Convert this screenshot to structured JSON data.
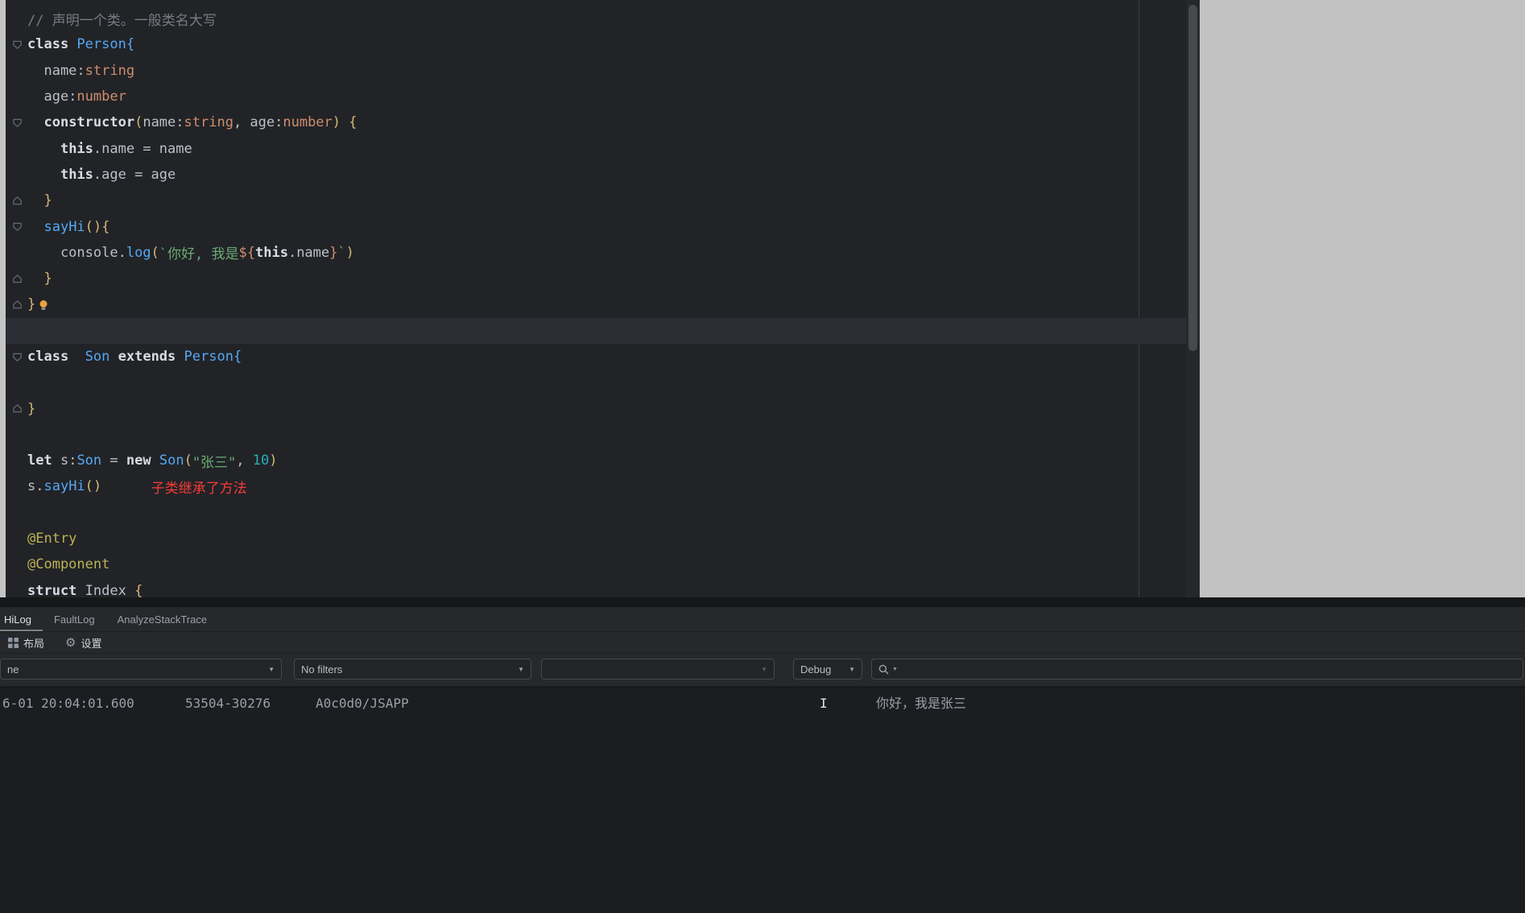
{
  "colors": {
    "annotation_red": "#f53b3b",
    "bulb_yellow": "#e9a33f",
    "class_blue": "#56a8f5",
    "string_green": "#6aab73"
  },
  "editor": {
    "lines": [
      {
        "tokens": [
          {
            "t": "// 声明一个类。一般类名大写",
            "k": "cm"
          }
        ]
      },
      {
        "marker": "down",
        "tokens": [
          {
            "t": "class ",
            "k": "kw"
          },
          {
            "t": "Person{",
            "k": "cls"
          }
        ]
      },
      {
        "tokens": [
          {
            "t": "  name:",
            "k": "fg"
          },
          {
            "t": "string",
            "k": "type"
          }
        ]
      },
      {
        "tokens": [
          {
            "t": "  age:",
            "k": "fg"
          },
          {
            "t": "number",
            "k": "type"
          }
        ]
      },
      {
        "marker": "down",
        "tokens": [
          {
            "t": "  ",
            "k": "fg"
          },
          {
            "t": "constructor",
            "k": "kw"
          },
          {
            "t": "(",
            "k": "paren"
          },
          {
            "t": "name:",
            "k": "fg"
          },
          {
            "t": "string",
            "k": "type"
          },
          {
            "t": ", age:",
            "k": "fg"
          },
          {
            "t": "number",
            "k": "type"
          },
          {
            "t": ")",
            "k": "paren"
          },
          {
            "t": " ",
            "k": "fg"
          },
          {
            "t": "{",
            "k": "paren"
          }
        ]
      },
      {
        "tokens": [
          {
            "t": "    ",
            "k": "fg"
          },
          {
            "t": "this",
            "k": "kw"
          },
          {
            "t": ".name = name",
            "k": "fg"
          }
        ]
      },
      {
        "tokens": [
          {
            "t": "    ",
            "k": "fg"
          },
          {
            "t": "this",
            "k": "kw"
          },
          {
            "t": ".age = age",
            "k": "fg"
          }
        ]
      },
      {
        "marker": "up",
        "tokens": [
          {
            "t": "  ",
            "k": "fg"
          },
          {
            "t": "}",
            "k": "paren"
          }
        ]
      },
      {
        "marker": "down",
        "tokens": [
          {
            "t": "  ",
            "k": "fg"
          },
          {
            "t": "sayHi",
            "k": "cls"
          },
          {
            "t": "(){",
            "k": "paren"
          }
        ]
      },
      {
        "tokens": [
          {
            "t": "    console.",
            "k": "fg"
          },
          {
            "t": "log",
            "k": "cls"
          },
          {
            "t": "(",
            "k": "paren"
          },
          {
            "t": "`你好, 我是",
            "k": "str"
          },
          {
            "t": "${",
            "k": "type"
          },
          {
            "t": "this",
            "k": "kw"
          },
          {
            "t": ".name",
            "k": "fg"
          },
          {
            "t": "}",
            "k": "type"
          },
          {
            "t": "`",
            "k": "str"
          },
          {
            "t": ")",
            "k": "paren"
          }
        ]
      },
      {
        "marker": "up",
        "tokens": [
          {
            "t": "  ",
            "k": "fg"
          },
          {
            "t": "}",
            "k": "paren"
          }
        ]
      },
      {
        "marker": "up",
        "bulb": true,
        "tokens": [
          {
            "t": "}",
            "k": "paren"
          }
        ]
      },
      {
        "hl": true,
        "tokens": []
      },
      {
        "marker": "down",
        "tokens": [
          {
            "t": "class  ",
            "k": "kw"
          },
          {
            "t": "Son",
            "k": "cls"
          },
          {
            "t": " ",
            "k": "fg"
          },
          {
            "t": "extends",
            "k": "kw"
          },
          {
            "t": " ",
            "k": "fg"
          },
          {
            "t": "Person{",
            "k": "cls"
          }
        ]
      },
      {
        "tokens": []
      },
      {
        "marker": "up",
        "tokens": [
          {
            "t": "}",
            "k": "paren"
          }
        ]
      },
      {
        "tokens": []
      },
      {
        "tokens": [
          {
            "t": "let ",
            "k": "kw"
          },
          {
            "t": "s:",
            "k": "fg"
          },
          {
            "t": "Son",
            "k": "cls"
          },
          {
            "t": " = ",
            "k": "fg"
          },
          {
            "t": "new",
            "k": "kw"
          },
          {
            "t": " ",
            "k": "fg"
          },
          {
            "t": "Son",
            "k": "cls"
          },
          {
            "t": "(",
            "k": "paren"
          },
          {
            "t": "\"张三\"",
            "k": "str"
          },
          {
            "t": ", ",
            "k": "fg"
          },
          {
            "t": "10",
            "k": "num"
          },
          {
            "t": ")",
            "k": "paren"
          }
        ]
      },
      {
        "tokens": [
          {
            "t": "s.",
            "k": "fg"
          },
          {
            "t": "sayHi",
            "k": "cls"
          },
          {
            "t": "()",
            "k": "paren"
          },
          {
            "t": "      子类继承了方法",
            "k": "red"
          }
        ]
      },
      {
        "tokens": []
      },
      {
        "tokens": [
          {
            "t": "@Entry",
            "k": "ann"
          }
        ]
      },
      {
        "tokens": [
          {
            "t": "@Component",
            "k": "ann"
          }
        ]
      },
      {
        "tokens": [
          {
            "t": "struct ",
            "k": "kw"
          },
          {
            "t": "Index ",
            "k": "fg"
          },
          {
            "t": "{",
            "k": "paren"
          }
        ]
      }
    ]
  },
  "panel": {
    "tabs": [
      {
        "label": "HiLog"
      },
      {
        "label": "FaultLog"
      },
      {
        "label": "AnalyzeStackTrace"
      }
    ],
    "toolbar": {
      "layout_label": "布局",
      "settings_label": "设置"
    },
    "filters": {
      "device_value": "ne",
      "filter_value": "No filters",
      "process_value": "",
      "level_value": "Debug",
      "search_value": ""
    },
    "log": {
      "time": "6-01 20:04:01.600",
      "pid": "53504-30276",
      "tag": "A0c0d0/JSAPP",
      "level": "I",
      "message": "你好，我是张三"
    }
  }
}
